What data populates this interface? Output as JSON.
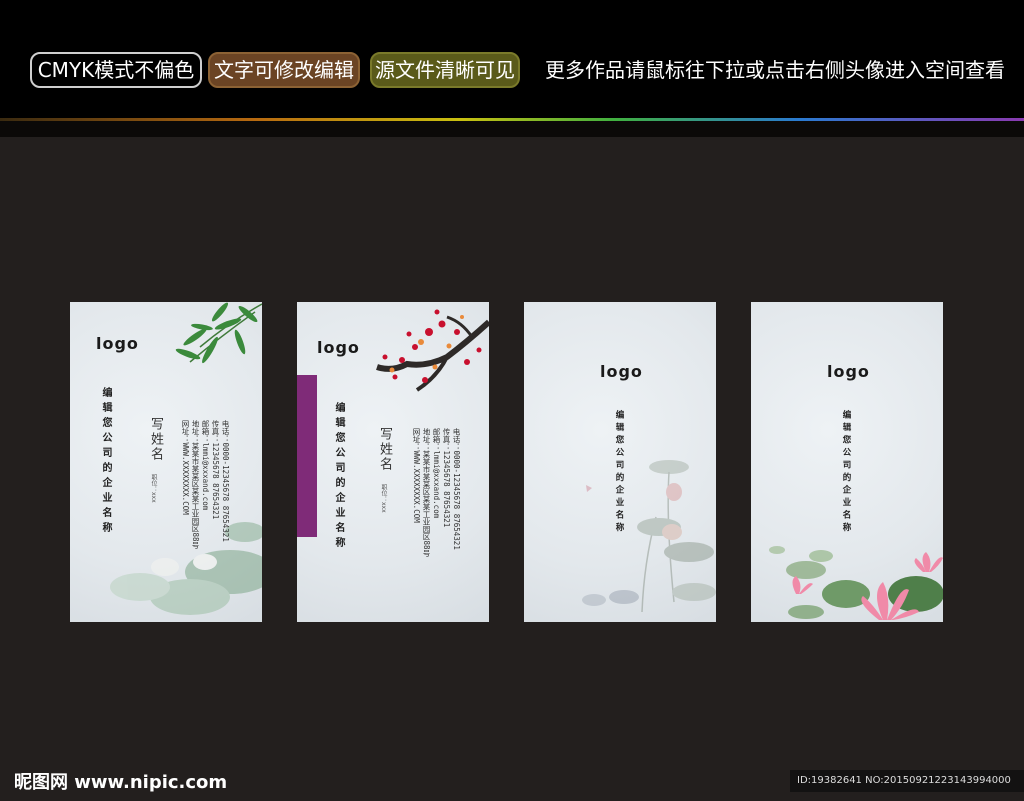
{
  "header": {
    "tags": [
      "CMYK模式不偏色",
      "文字可修改编辑",
      "源文件清晰可见"
    ],
    "promo": "更多作品请鼠标往下拉或点击右侧头像进入空间查看"
  },
  "cards": [
    {
      "logo": "logo",
      "company": "编辑您公司的企业名称",
      "name": "写姓名",
      "job_title": "职位：xxx",
      "info": [
        "电话：0000-12345678  87654321",
        "传真：12345678  87654321",
        "邮箱：lmmi@xxxand.com",
        "地址：某某市某某区某某工业园区88号",
        "网址：WWW.XXXXXXXX.COM"
      ]
    },
    {
      "logo": "logo",
      "company": "编辑您公司的企业名称",
      "name": "写姓名",
      "job_title": "职位：xxx",
      "info": [
        "电话：0000-12345678  87654321",
        "传真：12345678  87654321",
        "邮箱：lmmi@xxxand.com",
        "地址：某某市某某区某某工业园区88号",
        "网址：WWW.XXXXXXXX.COM"
      ]
    },
    {
      "logo": "logo",
      "company": "编辑您公司的企业名称"
    },
    {
      "logo": "logo",
      "company": "编辑您公司的企业名称"
    }
  ],
  "footer": {
    "site": "昵图网 www.nipic.com",
    "id": "ID:19382641 NO:20150921223143994000"
  },
  "colors": {
    "accent_purple": "#7f2b78",
    "background": "#231f1e"
  }
}
